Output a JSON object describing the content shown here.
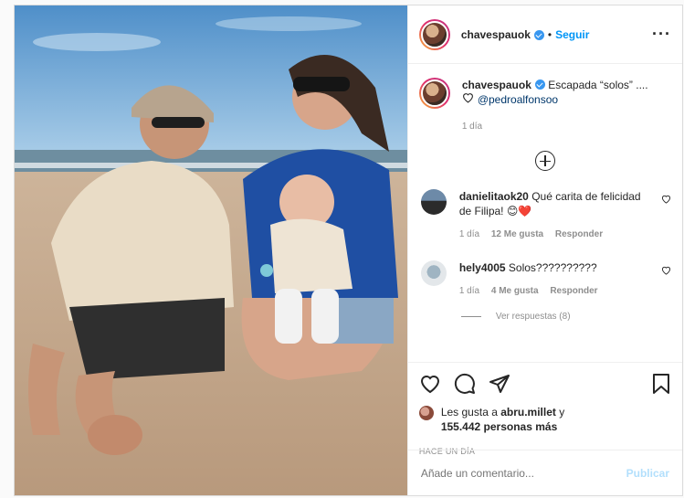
{
  "post": {
    "username": "chavespauok",
    "follow_label": "Seguir",
    "dot": "•",
    "more_icon": "more-options-icon"
  },
  "caption": {
    "username": "chavespauok",
    "text": "Escapada “solos” ....",
    "mention": "@pedroalfonsoo",
    "time": "1 día"
  },
  "comments": [
    {
      "username": "danielitaok20",
      "text": "Qué carita de felicidad de Filipa! 😊❤️",
      "time": "1 día",
      "likes": "12 Me gusta",
      "reply": "Responder"
    },
    {
      "username": "hely4005",
      "text": "Solos??????????",
      "time": "1 día",
      "likes": "4 Me gusta",
      "reply": "Responder",
      "replies_label": "Ver respuestas (8)"
    }
  ],
  "likes": {
    "prefix": "Les gusta a",
    "user": "abru.millet",
    "connector": "y",
    "count": "155.442 personas más"
  },
  "timestamp": "Hace un día",
  "add_comment": {
    "placeholder": "Añade un comentario...",
    "publish": "Publicar"
  },
  "colors": {
    "accent": "#0095f6",
    "publish_disabled": "#b2dffc",
    "verified": "#3897f0"
  }
}
